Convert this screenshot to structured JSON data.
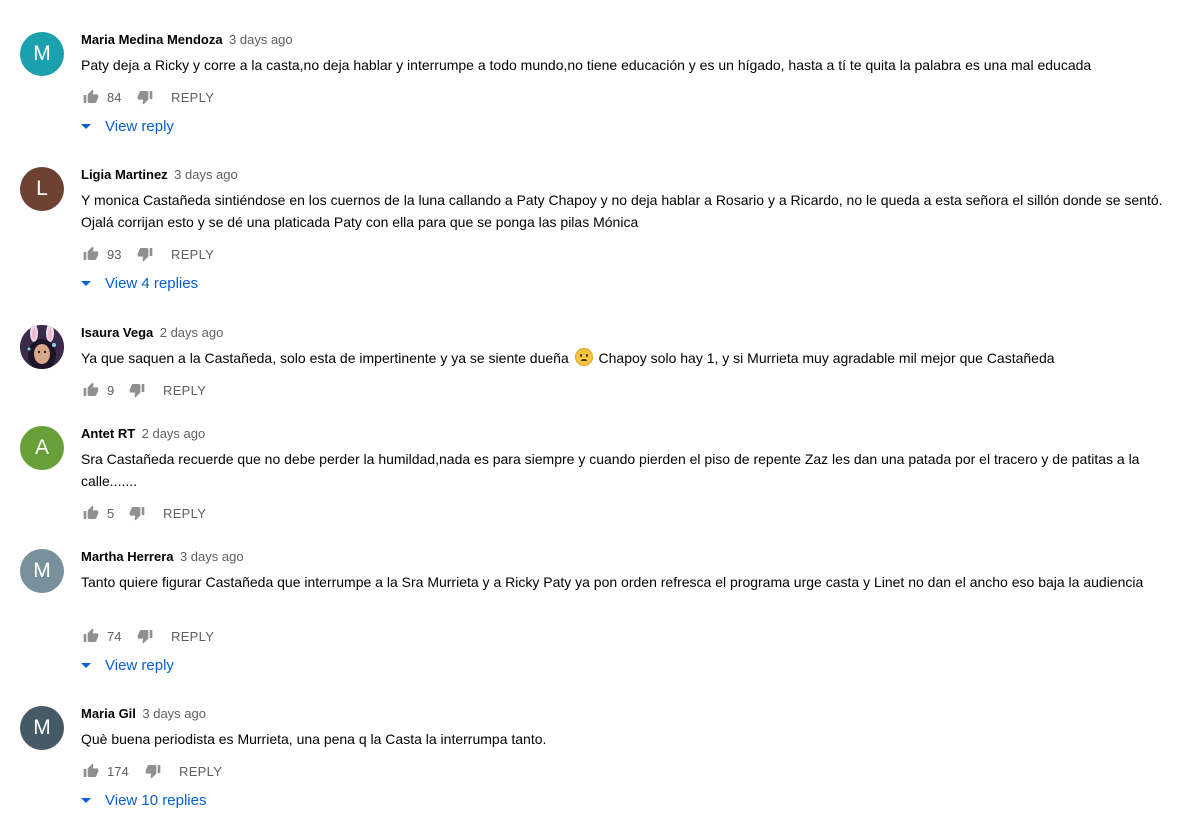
{
  "comments": [
    {
      "author": "Maria Medina Mendoza",
      "time": "3 days ago",
      "avatar_letter": "M",
      "avatar_color": "#1ba1ad",
      "text": "Paty deja a Ricky y corre a la casta,no deja hablar y interrumpe a todo mundo,no tiene educación y es un hígado, hasta a tí te quita la palabra es una mal educada",
      "likes": "84",
      "reply_label": "REPLY",
      "view_replies": "View reply"
    },
    {
      "author": "Ligia Martinez",
      "time": "3 days ago",
      "avatar_letter": "L",
      "avatar_color": "#6d4233",
      "text": "Y monica Castañeda sintiéndose en los cuernos de la luna callando a Paty Chapoy y no deja hablar a Rosario y a Ricardo, no le queda a esta señora el sillón donde se sentó. Ojalá corrijan esto y se dé una platicada Paty con ella para que se ponga las pilas Mónica",
      "likes": "93",
      "reply_label": "REPLY",
      "view_replies": "View 4 replies"
    },
    {
      "author": "Isaura Vega",
      "time": "2 days ago",
      "avatar_type": "photo",
      "text_before_emoji": "Ya que saquen a la Castañeda, solo esta de impertinente y ya se siente dueña",
      "emoji": "worried-face-emoji",
      "text_after_emoji": "Chapoy solo hay 1, y si Murrieta muy agradable mil mejor que Castañeda",
      "likes": "9",
      "reply_label": "REPLY"
    },
    {
      "author": "Antet RT",
      "time": "2 days ago",
      "avatar_letter": "A",
      "avatar_color": "#689f38",
      "text": "Sra Castañeda recuerde que no debe perder la humildad,nada es para siempre y cuando pierden el piso de repente Zaz les dan una patada por el tracero  y de patitas a la calle.......",
      "likes": "5",
      "reply_label": "REPLY"
    },
    {
      "author": "Martha Herrera",
      "time": "3 days ago",
      "avatar_letter": "M",
      "avatar_color": "#78909c",
      "text": "Tanto quiere figurar Castañeda que interrumpe a la Sra Murrieta y a Ricky  Paty ya pon orden refresca el programa urge casta y Linet no dan el ancho eso baja la audiencia",
      "likes": "74",
      "reply_label": "REPLY",
      "view_replies": "View reply"
    },
    {
      "author": "Maria Gil",
      "time": "3 days ago",
      "avatar_letter": "M",
      "avatar_color": "#455a64",
      "text": "Què buena periodista es Murrieta, una pena q la Casta la interrumpa tanto.",
      "likes": "174",
      "reply_label": "REPLY",
      "view_replies": "View 10 replies"
    }
  ],
  "icons": {
    "like": "thumb-up-icon",
    "dislike": "thumb-down-icon",
    "expand": "caret-down-icon"
  },
  "colors": {
    "link_blue": "#065fd4",
    "secondary_text": "#606060",
    "icon_gray": "#909090"
  }
}
